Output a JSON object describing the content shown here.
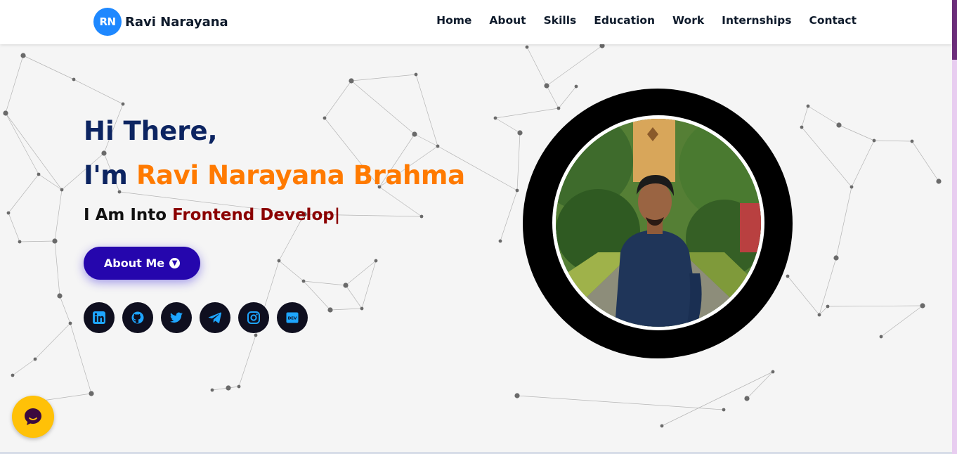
{
  "brand": {
    "initials": "RN",
    "name": "Ravi Narayana"
  },
  "nav": {
    "home": "Home",
    "about": "About",
    "skills": "Skills",
    "education": "Education",
    "work": "Work",
    "internships": "Internships",
    "contact": "Contact"
  },
  "hero": {
    "greeting": "Hi There,",
    "intro_prefix": "I'm ",
    "name": "Ravi Narayana Brahma",
    "typed_prefix": "I Am Into ",
    "typed_text": "Frontend Develop",
    "caret": "|",
    "about_button": "About Me"
  },
  "socials": [
    {
      "name": "linkedin-icon"
    },
    {
      "name": "github-icon"
    },
    {
      "name": "twitter-icon"
    },
    {
      "name": "telegram-icon"
    },
    {
      "name": "instagram-icon"
    },
    {
      "name": "dev-icon",
      "label": "DEV"
    }
  ],
  "colors": {
    "navy": "#0c2461",
    "orange": "#ff7a00",
    "dark_red": "#8b0000",
    "button_purple": "#2506ad",
    "social_icon_blue": "#1ea5ff",
    "chat_yellow": "#ffc107"
  }
}
